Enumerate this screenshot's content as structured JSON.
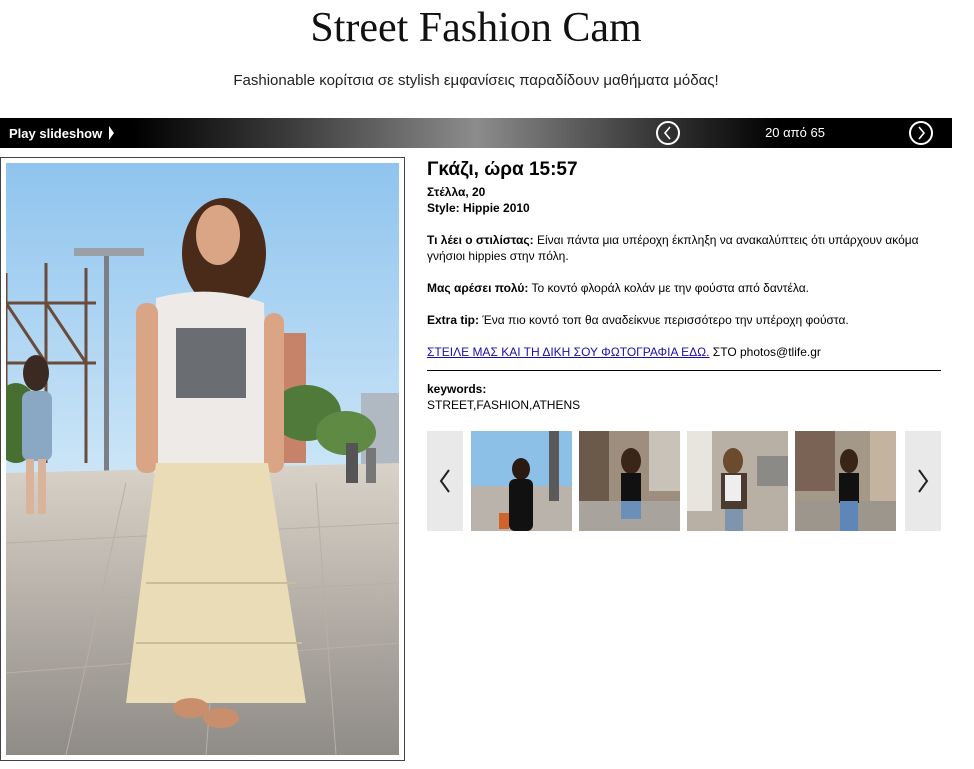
{
  "header": {
    "title": "Street Fashion Cam",
    "subtitle": "Fashionable κορίτσια σε stylish εμφανίσεις παραδίδουν μαθήματα μόδας!"
  },
  "slideshow": {
    "play_label": "Play slideshow",
    "counter": "20 από 65"
  },
  "icons": {
    "play": "play-triangle-icon",
    "prev": "chevron-left-icon",
    "next": "chevron-right-icon"
  },
  "entry": {
    "headline": "Γκάζι, ώρα 15:57",
    "person": "Στέλλα, 20",
    "style_label": "Style:",
    "style_value": "Hippie 2010",
    "stylist_label": "Τι λέει ο στιλίστας:",
    "stylist_text": "Είναι πάντα μια υπέροχη έκπληξη να ανακαλύπτεις ότι υπάρχουν ακόμα γνήσιοι hippies στην πόλη.",
    "likes_label": "Μας αρέσει πολύ:",
    "likes_text": "Το κοντό φλοράλ κολάν με την φούστα από δαντέλα.",
    "tip_label": "Extra tip:",
    "tip_text": "Ένα πιο κοντό τοπ θα αναδείκνυε περισσότερο την υπέροχη φούστα.",
    "submit_link": "ΣΤΕΙΛΕ ΜΑΣ ΚΑΙ ΤΗ ΔΙΚΗ ΣΟΥ ΦΩΤΟΓΡΑΦΙΑ ΕΔΩ.",
    "submit_suffix": "ΣΤΟ photos@tlife.gr",
    "keywords_label": "keywords:",
    "keywords": "STREET,FASHION,ATHENS"
  },
  "colors": {
    "link": "#1a0dab",
    "bar_dark": "#000000",
    "bar_light": "#8c8c8c",
    "carousel_arrow_bg": "#e9e9e9"
  }
}
